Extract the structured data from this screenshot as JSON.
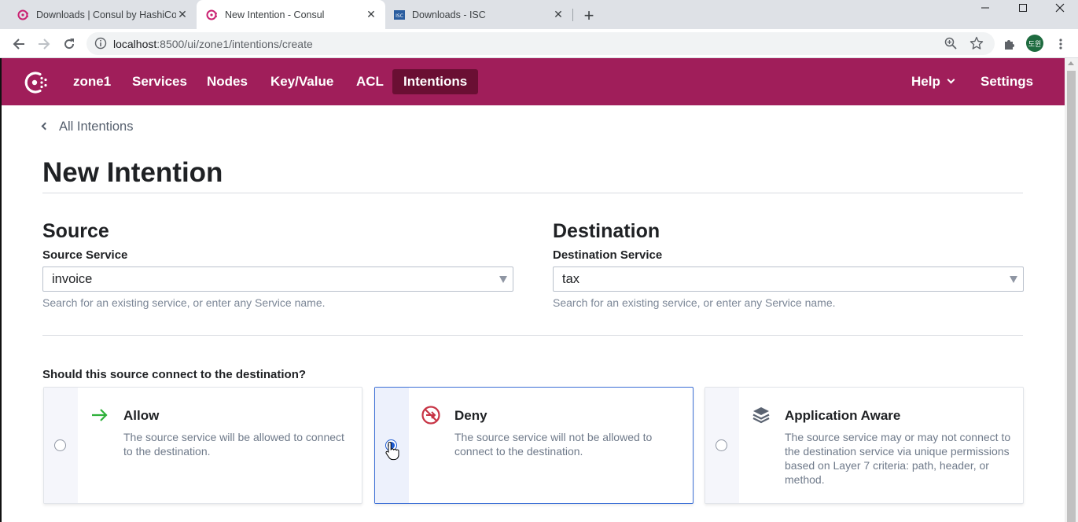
{
  "browser": {
    "tabs": [
      {
        "title": "Downloads | Consul by HashiCo",
        "icon": "consul-favicon",
        "active": false
      },
      {
        "title": "New Intention - Consul",
        "icon": "consul-favicon",
        "active": true
      },
      {
        "title": "Downloads - ISC",
        "icon": "isc-favicon",
        "active": false
      }
    ],
    "url_host": "localhost",
    "url_rest": ":8500/ui/zone1/intentions/create",
    "profile_initials": "도윈"
  },
  "nav": {
    "dc": "zone1",
    "items": [
      "Services",
      "Nodes",
      "Key/Value",
      "ACL",
      "Intentions"
    ],
    "active": "Intentions",
    "help": "Help",
    "settings": "Settings"
  },
  "page": {
    "breadcrumb": "All Intentions",
    "title": "New Intention"
  },
  "source": {
    "heading": "Source",
    "label": "Source Service",
    "value": "invoice",
    "help": "Search for an existing service, or enter any Service name."
  },
  "destination": {
    "heading": "Destination",
    "label": "Destination Service",
    "value": "tax",
    "help": "Search for an existing service, or enter any Service name."
  },
  "action": {
    "question": "Should this source connect to the destination?",
    "options": [
      {
        "title": "Allow",
        "description": "The source service will be allowed to connect to the destination.",
        "icon": "arrow-right-icon",
        "selected": false
      },
      {
        "title": "Deny",
        "description": "The source service will not be allowed to connect to the destination.",
        "icon": "deny-icon",
        "selected": true
      },
      {
        "title": "Application Aware",
        "description": "The source service may or may not connect to the destination service via unique permissions based on Layer 7 criteria: path, header, or method.",
        "icon": "layers-icon",
        "selected": false
      }
    ]
  },
  "colors": {
    "brand": "#a01e5a",
    "nav_active": "#6a0f33",
    "selected_border": "#3c6fd6",
    "allow": "#2eb039",
    "deny": "#c73445"
  }
}
